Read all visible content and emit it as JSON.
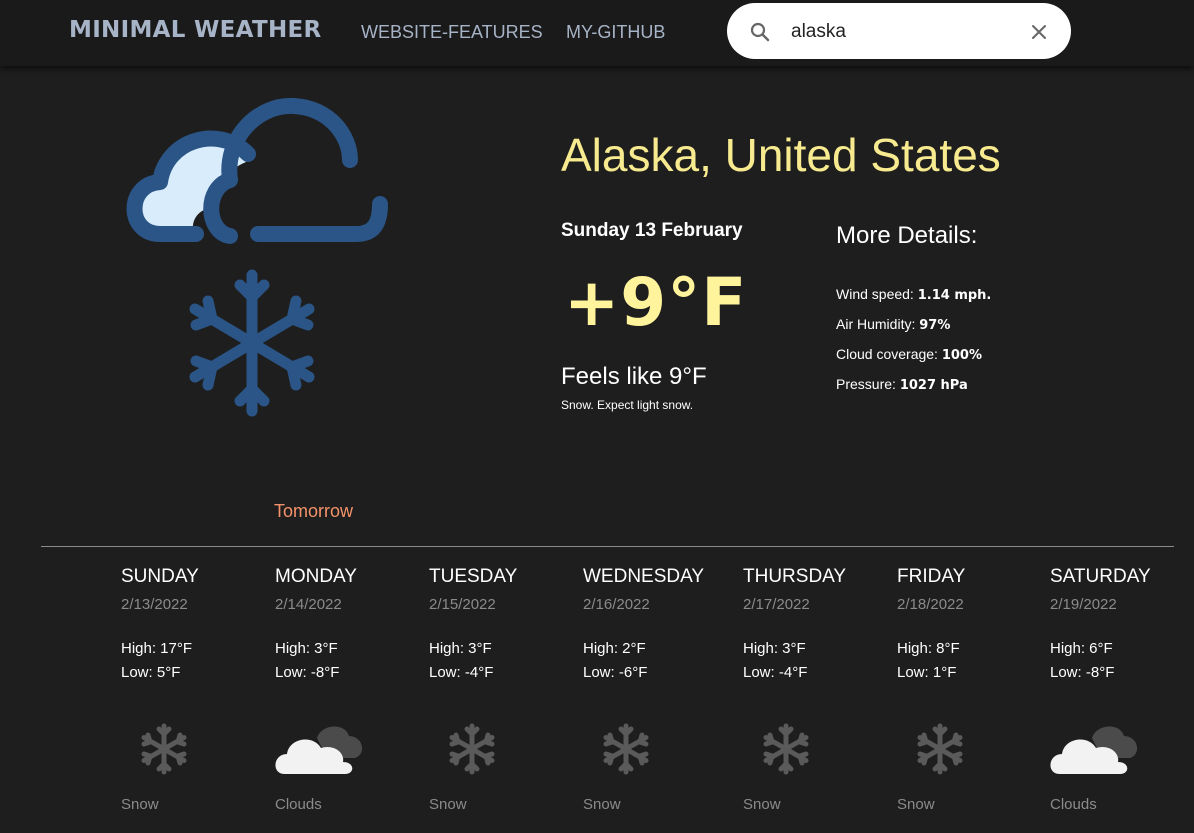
{
  "nav": {
    "brand": "MINIMAL WEATHER",
    "links": [
      "WEBSITE-FEATURES",
      "MY-GITHUB"
    ]
  },
  "search": {
    "value": "alaska",
    "icon": "search-icon",
    "clear_icon": "close-icon"
  },
  "current": {
    "icon": "cloud-snow-icon",
    "location": "Alaska, United States",
    "date": "Sunday 13 February",
    "temperature": "+9°F",
    "feels_like": "Feels like 9°F",
    "description": "Snow. Expect light snow."
  },
  "details": {
    "title": "More Details:",
    "items": [
      {
        "label": "Wind speed:",
        "value": "1.14 mph."
      },
      {
        "label": "Air Humidity:",
        "value": "97%"
      },
      {
        "label": "Cloud coverage:",
        "value": "100%"
      },
      {
        "label": "Pressure:",
        "value": "1027 hPa"
      }
    ]
  },
  "forecast": {
    "tab_label": "Tomorrow",
    "days": [
      {
        "name": "SUNDAY",
        "date": "2/13/2022",
        "high": "High: 17°F",
        "low": "Low: 5°F",
        "icon": "snowflake-icon",
        "condition": "Snow"
      },
      {
        "name": "MONDAY",
        "date": "2/14/2022",
        "high": "High: 3°F",
        "low": "Low: -8°F",
        "icon": "clouds-icon",
        "condition": "Clouds"
      },
      {
        "name": "TUESDAY",
        "date": "2/15/2022",
        "high": "High: 3°F",
        "low": "Low: -4°F",
        "icon": "snowflake-icon",
        "condition": "Snow"
      },
      {
        "name": "WEDNESDAY",
        "date": "2/16/2022",
        "high": "High: 2°F",
        "low": "Low: -6°F",
        "icon": "snowflake-icon",
        "condition": "Snow"
      },
      {
        "name": "THURSDAY",
        "date": "2/17/2022",
        "high": "High: 3°F",
        "low": "Low: -4°F",
        "icon": "snowflake-icon",
        "condition": "Snow"
      },
      {
        "name": "FRIDAY",
        "date": "2/18/2022",
        "high": "High: 8°F",
        "low": "Low: 1°F",
        "icon": "snowflake-icon",
        "condition": "Snow"
      },
      {
        "name": "SATURDAY",
        "date": "2/19/2022",
        "high": "High: 6°F",
        "low": "Low: -8°F",
        "icon": "clouds-icon",
        "condition": "Clouds"
      }
    ]
  },
  "colors": {
    "background": "#1e1e1e",
    "topbar": "#1a1a1a",
    "nav_text": "#a7b3c6",
    "location": "#f7ea8f",
    "temperature": "#fff49b",
    "tab_accent": "#f4926a",
    "muted": "#8b8b8b",
    "icon_blue": "#2a5586",
    "icon_light": "#d8ecfb"
  }
}
